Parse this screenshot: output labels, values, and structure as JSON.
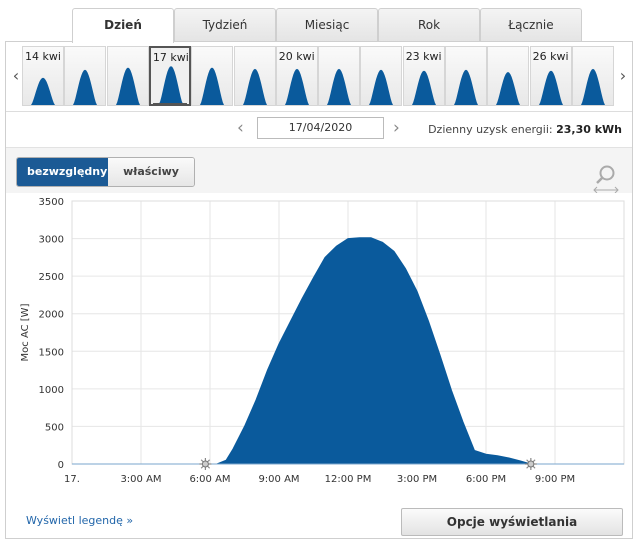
{
  "tabs": [
    {
      "label": "Dzień",
      "active": true
    },
    {
      "label": "Tydzień",
      "active": false
    },
    {
      "label": "Miesiąc",
      "active": false
    },
    {
      "label": "Rok",
      "active": false
    },
    {
      "label": "Łącznie",
      "active": false
    }
  ],
  "strip": {
    "prev_arrow": "‹",
    "next_arrow": "›",
    "thumbs": [
      {
        "label": "14 kwi",
        "peak": 0.62,
        "selected": false
      },
      {
        "label": "",
        "peak": 0.8,
        "selected": false
      },
      {
        "label": "",
        "peak": 0.85,
        "selected": false
      },
      {
        "label": "17 kwi",
        "peak": 0.86,
        "selected": true
      },
      {
        "label": "",
        "peak": 0.85,
        "selected": false
      },
      {
        "label": "",
        "peak": 0.82,
        "selected": false
      },
      {
        "label": "20 kwi",
        "peak": 0.82,
        "selected": false
      },
      {
        "label": "",
        "peak": 0.82,
        "selected": false
      },
      {
        "label": "",
        "peak": 0.8,
        "selected": false
      },
      {
        "label": "23 kwi",
        "peak": 0.78,
        "selected": false
      },
      {
        "label": "",
        "peak": 0.8,
        "selected": false
      },
      {
        "label": "",
        "peak": 0.75,
        "selected": false
      },
      {
        "label": "26 kwi",
        "peak": 0.78,
        "selected": false
      },
      {
        "label": "",
        "peak": 0.82,
        "selected": false
      }
    ]
  },
  "daterow": {
    "prev": "‹",
    "next": "›",
    "date": "17/04/2020",
    "yield_label": "Dzienny uzysk energii:",
    "yield_value": "23,30 kWh"
  },
  "toggle": {
    "absolute": "bezwzględny",
    "specific": "właściwy"
  },
  "colors": {
    "series": "#0a5a9c",
    "accent": "#1b5a95"
  },
  "chart_data": {
    "type": "area",
    "ylabel": "Moc AC [W]",
    "xlabel": "",
    "ylim": [
      0,
      3500
    ],
    "xlim": [
      0,
      24
    ],
    "yticks": [
      0,
      500,
      1000,
      1500,
      2000,
      2500,
      3000,
      3500
    ],
    "xtick_labels": [
      "17.",
      "3:00 AM",
      "6:00 AM",
      "9:00 AM",
      "12:00 PM",
      "3:00 PM",
      "6:00 PM",
      "9:00 PM"
    ],
    "xtick_values": [
      0,
      3,
      6,
      9,
      12,
      15,
      18,
      21
    ],
    "grid": true,
    "markers": [
      {
        "name": "sunrise-icon",
        "hour": 5.8
      },
      {
        "name": "sunset-icon",
        "hour": 19.95
      }
    ],
    "series": [
      {
        "values": [
          [
            6.3,
            0
          ],
          [
            6.7,
            50
          ],
          [
            7.0,
            200
          ],
          [
            7.5,
            500
          ],
          [
            8.0,
            850
          ],
          [
            8.5,
            1250
          ],
          [
            9.0,
            1600
          ],
          [
            9.5,
            1900
          ],
          [
            10.0,
            2200
          ],
          [
            10.5,
            2480
          ],
          [
            11.0,
            2750
          ],
          [
            11.5,
            2900
          ],
          [
            12.0,
            3000
          ],
          [
            12.5,
            3010
          ],
          [
            13.0,
            3010
          ],
          [
            13.5,
            2950
          ],
          [
            14.0,
            2830
          ],
          [
            14.5,
            2600
          ],
          [
            15.0,
            2300
          ],
          [
            15.5,
            1900
          ],
          [
            16.0,
            1450
          ],
          [
            16.5,
            980
          ],
          [
            17.0,
            560
          ],
          [
            17.5,
            180
          ],
          [
            18.0,
            130
          ],
          [
            18.5,
            110
          ],
          [
            19.0,
            80
          ],
          [
            19.5,
            40
          ],
          [
            19.95,
            0
          ]
        ]
      }
    ]
  },
  "footer": {
    "legend_link": "Wyświetl legendę »",
    "options_button": "Opcje wyświetlania"
  }
}
